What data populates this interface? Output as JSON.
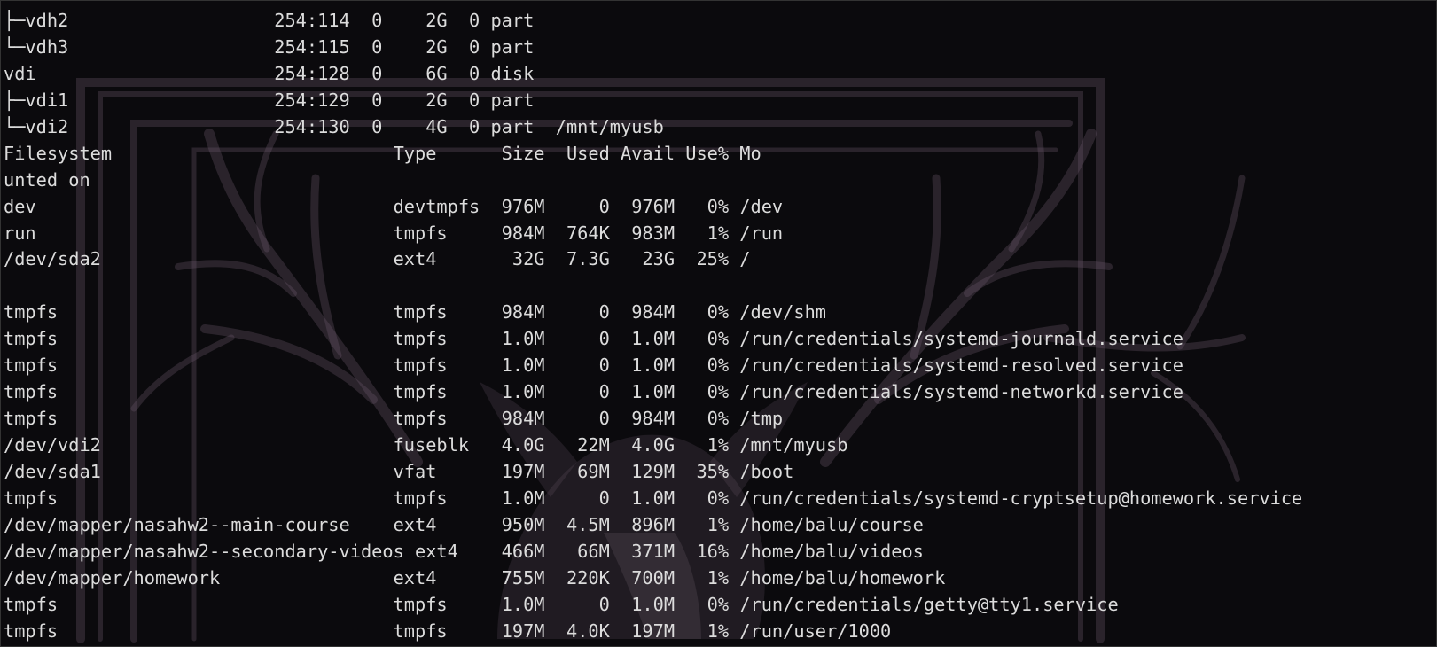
{
  "terminal": {
    "lines": [
      "├─vdh2                   254:114  0    2G  0 part",
      "└─vdh3                   254:115  0    2G  0 part",
      "vdi                      254:128  0    6G  0 disk",
      "├─vdi1                   254:129  0    2G  0 part",
      "└─vdi2                   254:130  0    4G  0 part  /mnt/myusb",
      "Filesystem                          Type      Size  Used Avail Use% Mo",
      "unted on",
      "dev                                 devtmpfs  976M     0  976M   0% /dev",
      "run                                 tmpfs     984M  764K  983M   1% /run",
      "/dev/sda2                           ext4       32G  7.3G   23G  25% /",
      "",
      "tmpfs                               tmpfs     984M     0  984M   0% /dev/shm",
      "tmpfs                               tmpfs     1.0M     0  1.0M   0% /run/credentials/systemd-journald.service",
      "tmpfs                               tmpfs     1.0M     0  1.0M   0% /run/credentials/systemd-resolved.service",
      "tmpfs                               tmpfs     1.0M     0  1.0M   0% /run/credentials/systemd-networkd.service",
      "tmpfs                               tmpfs     984M     0  984M   0% /tmp",
      "/dev/vdi2                           fuseblk   4.0G   22M  4.0G   1% /mnt/myusb",
      "/dev/sda1                           vfat      197M   69M  129M  35% /boot",
      "tmpfs                               tmpfs     1.0M     0  1.0M   0% /run/credentials/systemd-cryptsetup@homework.service",
      "/dev/mapper/nasahw2--main-course    ext4      950M  4.5M  896M   1% /home/balu/course",
      "/dev/mapper/nasahw2--secondary-videos ext4    466M   66M  371M  16% /home/balu/videos",
      "/dev/mapper/homework                ext4      755M  220K  700M   1% /home/balu/homework",
      "tmpfs                               tmpfs     1.0M     0  1.0M   0% /run/credentials/getty@tty1.service",
      "tmpfs                               tmpfs     197M  4.0K  197M   1% /run/user/1000"
    ]
  },
  "colors": {
    "background": "#0b0a0d",
    "text": "#dcdcdc",
    "wallpaper_tint": "#6e5a6e"
  },
  "icons": {
    "wallpaper": "deer-antlers-wallpaper"
  }
}
